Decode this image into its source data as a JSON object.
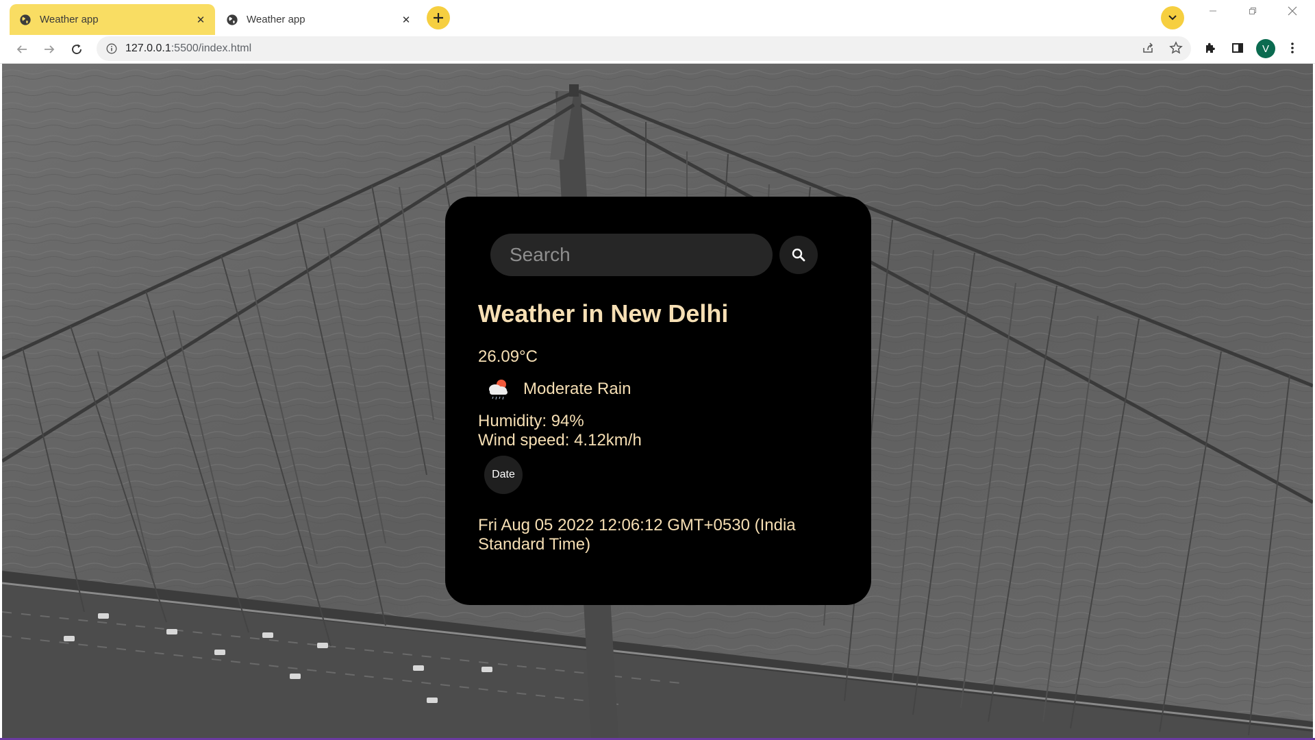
{
  "browser": {
    "tabs": [
      {
        "title": "Weather app",
        "active": true,
        "icon": "globe-icon"
      },
      {
        "title": "Weather app",
        "active": false,
        "icon": "globe-icon"
      }
    ],
    "address": {
      "host": "127.0.0.1",
      "path": ":5500/index.html"
    },
    "profile_initial": "V",
    "accent": "#f9dd63"
  },
  "weather": {
    "search_placeholder": "Search",
    "city_heading": "Weather in New Delhi",
    "temperature": "26.09°C",
    "description": "Moderate Rain",
    "condition_icon": "rain-cloud-icon",
    "humidity": "Humidity: 94%",
    "wind": "Wind speed: 4.12km/h",
    "date_button": "Date",
    "datetime": "Fri Aug 05 2022 12:06:12 GMT+0530 (India Standard Time)",
    "text_color": "#f6dfb4"
  }
}
